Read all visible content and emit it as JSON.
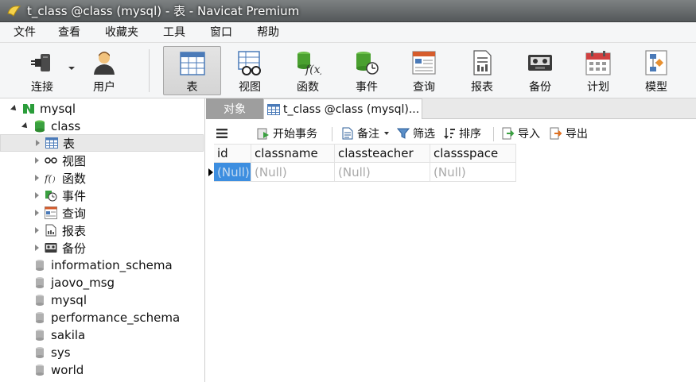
{
  "window": {
    "title": "t_class @class (mysql) - 表 - Navicat Premium"
  },
  "menu": [
    "文件",
    "查看",
    "收藏夹",
    "工具",
    "窗口",
    "帮助"
  ],
  "toolbar": {
    "connect": "连接",
    "user": "用户",
    "table": "表",
    "view": "视图",
    "function": "函数",
    "event": "事件",
    "query": "查询",
    "report": "报表",
    "backup": "备份",
    "schedule": "计划",
    "model": "模型"
  },
  "tree": {
    "connection": "mysql",
    "database": "class",
    "children": [
      "表",
      "视图",
      "函数",
      "事件",
      "查询",
      "报表",
      "备份"
    ],
    "other_databases": [
      "information_schema",
      "jaovo_msg",
      "mysql",
      "performance_schema",
      "sakila",
      "sys",
      "world"
    ]
  },
  "tabs": {
    "objects": "对象",
    "current": "t_class @class (mysql)..."
  },
  "table_toolbar": {
    "begin_transaction": "开始事务",
    "memo": "备注",
    "filter": "筛选",
    "sort": "排序",
    "import": "导入",
    "export": "导出"
  },
  "grid": {
    "columns": [
      "id",
      "classname",
      "classteacher",
      "classspace"
    ],
    "rows": [
      [
        "(Null)",
        "(Null)",
        "(Null)",
        "(Null)"
      ]
    ]
  },
  "colors": {
    "selection": "#3d8ee0",
    "titlebar": "#6a6e70",
    "db_green": "#3aa040"
  }
}
